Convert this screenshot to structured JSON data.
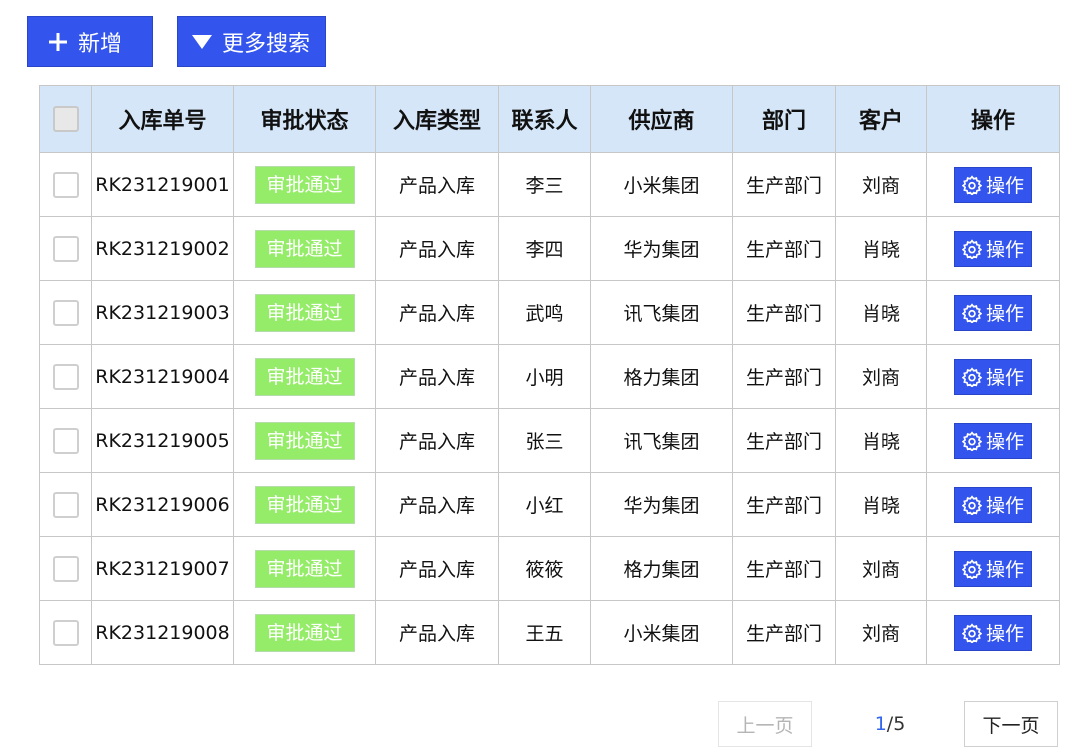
{
  "toolbar": {
    "add_label": "新增",
    "more_search_label": "更多搜索"
  },
  "table": {
    "headers": [
      "入库单号",
      "审批状态",
      "入库类型",
      "联系人",
      "供应商",
      "部门",
      "客户",
      "操作"
    ],
    "rows": [
      {
        "id": "RK231219001",
        "status": "审批通过",
        "type": "产品入库",
        "contact": "李三",
        "supplier": "小米集团",
        "dept": "生产部门",
        "customer": "刘商",
        "action": "操作"
      },
      {
        "id": "RK231219002",
        "status": "审批通过",
        "type": "产品入库",
        "contact": "李四",
        "supplier": "华为集团",
        "dept": "生产部门",
        "customer": "肖晓",
        "action": "操作"
      },
      {
        "id": "RK231219003",
        "status": "审批通过",
        "type": "产品入库",
        "contact": "武鸣",
        "supplier": "讯飞集团",
        "dept": "生产部门",
        "customer": "肖晓",
        "action": "操作"
      },
      {
        "id": "RK231219004",
        "status": "审批通过",
        "type": "产品入库",
        "contact": "小明",
        "supplier": "格力集团",
        "dept": "生产部门",
        "customer": "刘商",
        "action": "操作"
      },
      {
        "id": "RK231219005",
        "status": "审批通过",
        "type": "产品入库",
        "contact": "张三",
        "supplier": "讯飞集团",
        "dept": "生产部门",
        "customer": "肖晓",
        "action": "操作"
      },
      {
        "id": "RK231219006",
        "status": "审批通过",
        "type": "产品入库",
        "contact": "小红",
        "supplier": "华为集团",
        "dept": "生产部门",
        "customer": "肖晓",
        "action": "操作"
      },
      {
        "id": "RK231219007",
        "status": "审批通过",
        "type": "产品入库",
        "contact": "筱筱",
        "supplier": "格力集团",
        "dept": "生产部门",
        "customer": "刘商",
        "action": "操作"
      },
      {
        "id": "RK231219008",
        "status": "审批通过",
        "type": "产品入库",
        "contact": "王五",
        "supplier": "小米集团",
        "dept": "生产部门",
        "customer": "刘商",
        "action": "操作"
      }
    ]
  },
  "pagination": {
    "prev_label": "上一页",
    "current_page": "1",
    "separator": "/",
    "total_pages": "5",
    "next_label": "下一页"
  },
  "icons": {
    "add": "plus-icon",
    "more_search": "caret-down-icon",
    "action": "gear-icon"
  },
  "colors": {
    "primary": "#3355ee",
    "status_approved": "#95ec69",
    "header_bg": "#d5e6f8",
    "page_current": "#3366ee"
  }
}
